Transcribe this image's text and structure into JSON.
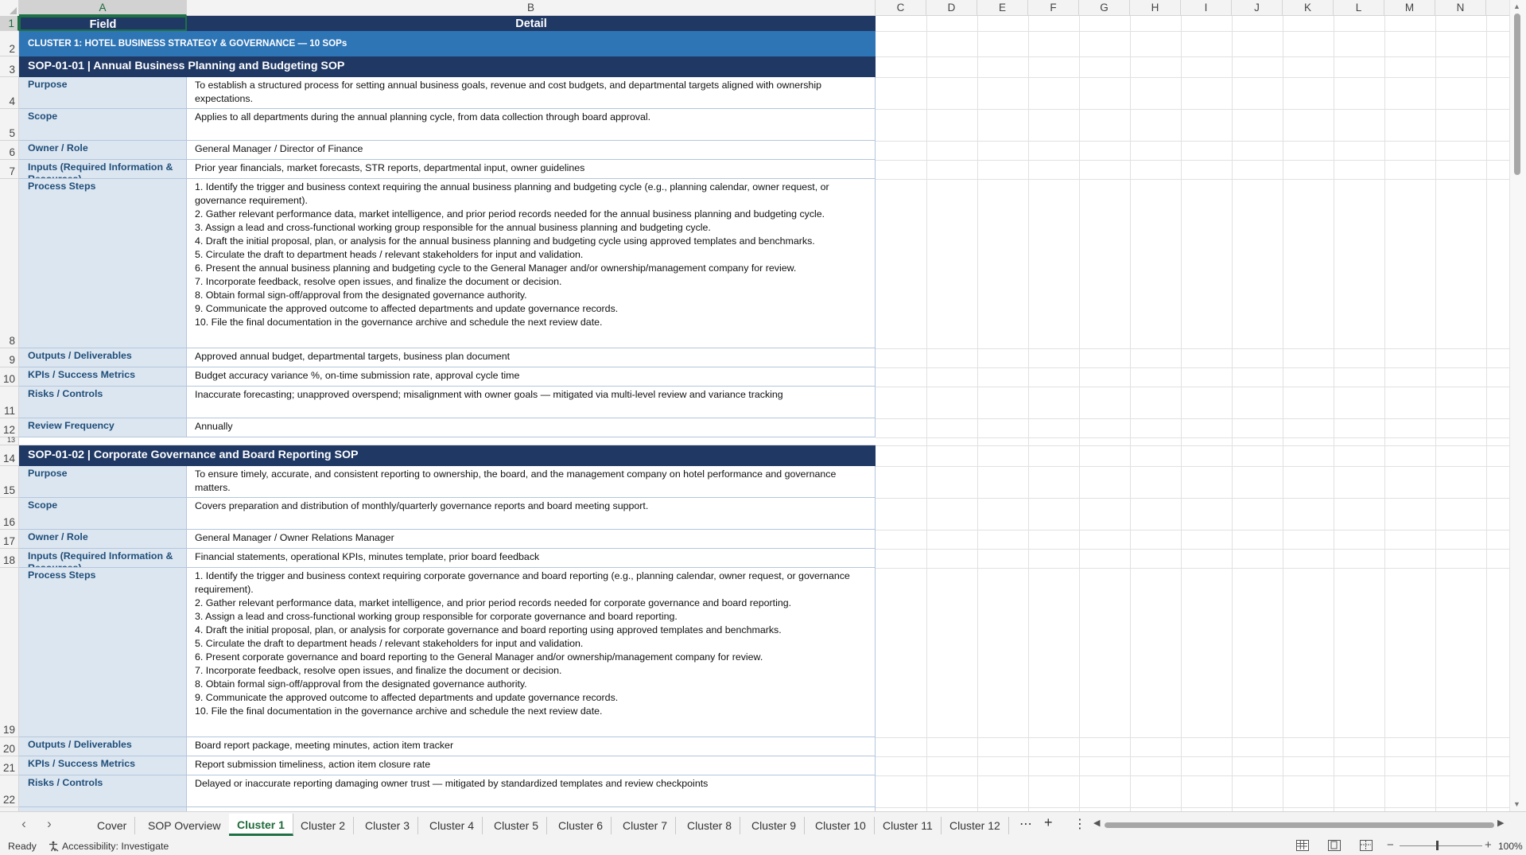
{
  "columns": [
    "A",
    "B",
    "C",
    "D",
    "E",
    "F",
    "G",
    "H",
    "I",
    "J",
    "K",
    "L",
    "M",
    "N"
  ],
  "header": {
    "field": "Field",
    "detail": "Detail"
  },
  "cluster_title": "CLUSTER 1: HOTEL BUSINESS STRATEGY & GOVERNANCE  —  10 SOPs",
  "sops": [
    {
      "title": "SOP-01-01  |  Annual Business Planning and Budgeting SOP",
      "rows": {
        "purpose_label": "Purpose",
        "purpose": "To establish a structured process for setting annual business goals, revenue and cost budgets, and departmental targets aligned with ownership expectations.",
        "scope_label": "Scope",
        "scope": "Applies to all departments during the annual planning cycle, from data collection through board approval.",
        "owner_label": "Owner / Role",
        "owner": "General Manager / Director of Finance",
        "inputs_label": "Inputs (Required Information & Resources)",
        "inputs": "Prior year financials, market forecasts, STR reports, departmental input, owner guidelines",
        "steps_label": "Process Steps",
        "steps": [
          "1. Identify the trigger and business context requiring the annual business planning and budgeting cycle (e.g., planning calendar, owner request, or governance requirement).",
          "2. Gather relevant performance data, market intelligence, and prior period records needed for the annual business planning and budgeting cycle.",
          "3. Assign a lead and cross-functional working group responsible for the annual business planning and budgeting cycle.",
          "4. Draft the initial proposal, plan, or analysis for the annual business planning and budgeting cycle using approved templates and benchmarks.",
          "5. Circulate the draft to department heads / relevant stakeholders for input and validation.",
          "6. Present the annual business planning and budgeting cycle to the General Manager and/or ownership/management company for review.",
          "7. Incorporate feedback, resolve open issues, and finalize the document or decision.",
          "8. Obtain formal sign-off/approval from the designated governance authority.",
          "9. Communicate the approved outcome to affected departments and update governance records.",
          "10. File the final documentation in the governance archive and schedule the next review date."
        ],
        "outputs_label": "Outputs / Deliverables",
        "outputs": "Approved annual budget, departmental targets, business plan document",
        "kpis_label": "KPIs / Success Metrics",
        "kpis": "Budget accuracy variance %, on-time submission rate, approval cycle time",
        "risks_label": "Risks / Controls",
        "risks": "Inaccurate forecasting; unapproved overspend; misalignment with owner goals — mitigated via multi-level review and variance tracking",
        "review_label": "Review Frequency",
        "review": "Annually"
      }
    },
    {
      "title": "SOP-01-02  |  Corporate Governance and Board Reporting SOP",
      "rows": {
        "purpose_label": "Purpose",
        "purpose": "To ensure timely, accurate, and consistent reporting to ownership, the board, and the management company on hotel performance and governance matters.",
        "scope_label": "Scope",
        "scope": "Covers preparation and distribution of monthly/quarterly governance reports and board meeting support.",
        "owner_label": "Owner / Role",
        "owner": "General Manager / Owner Relations Manager",
        "inputs_label": "Inputs (Required Information & Resources)",
        "inputs": "Financial statements, operational KPIs, minutes template, prior board feedback",
        "steps_label": "Process Steps",
        "steps": [
          "1. Identify the trigger and business context requiring corporate governance and board reporting (e.g., planning calendar, owner request, or governance requirement).",
          "2. Gather relevant performance data, market intelligence, and prior period records needed for corporate governance and board reporting.",
          "3. Assign a lead and cross-functional working group responsible for corporate governance and board reporting.",
          "4. Draft the initial proposal, plan, or analysis for corporate governance and board reporting using approved templates and benchmarks.",
          "5. Circulate the draft to department heads / relevant stakeholders for input and validation.",
          "6. Present corporate governance and board reporting to the General Manager and/or ownership/management company for review.",
          "7. Incorporate feedback, resolve open issues, and finalize the document or decision.",
          "8. Obtain formal sign-off/approval from the designated governance authority.",
          "9. Communicate the approved outcome to affected departments and update governance records.",
          "10. File the final documentation in the governance archive and schedule the next review date."
        ],
        "outputs_label": "Outputs / Deliverables",
        "outputs": "Board report package, meeting minutes, action item tracker",
        "kpis_label": "KPIs / Success Metrics",
        "kpis": "Report submission timeliness, action item closure rate",
        "risks_label": "Risks / Controls",
        "risks": "Delayed or inaccurate reporting damaging owner trust — mitigated by standardized templates and review checkpoints"
      }
    }
  ],
  "row_numbers": [
    "1",
    "2",
    "3",
    "4",
    "5",
    "6",
    "7",
    "8",
    "9",
    "10",
    "11",
    "12",
    "13",
    "14",
    "15",
    "16",
    "17",
    "18",
    "19",
    "20",
    "21",
    "22"
  ],
  "tabs": [
    "Cover",
    "SOP Overview",
    "Cluster 1",
    "Cluster 2",
    "Cluster 3",
    "Cluster 4",
    "Cluster 5",
    "Cluster 6",
    "Cluster 7",
    "Cluster 8",
    "Cluster 9",
    "Cluster 10",
    "Cluster 11",
    "Cluster 12"
  ],
  "active_tab": "Cluster 1",
  "status": {
    "ready": "Ready",
    "accessibility": "Accessibility: Investigate",
    "zoom": "100%"
  },
  "colors": {
    "header_navy": "#1f3864",
    "cluster_blue": "#2e75b6",
    "label_fill": "#dce6f1",
    "label_text": "#1f4e79",
    "excel_green": "#1e7145"
  }
}
